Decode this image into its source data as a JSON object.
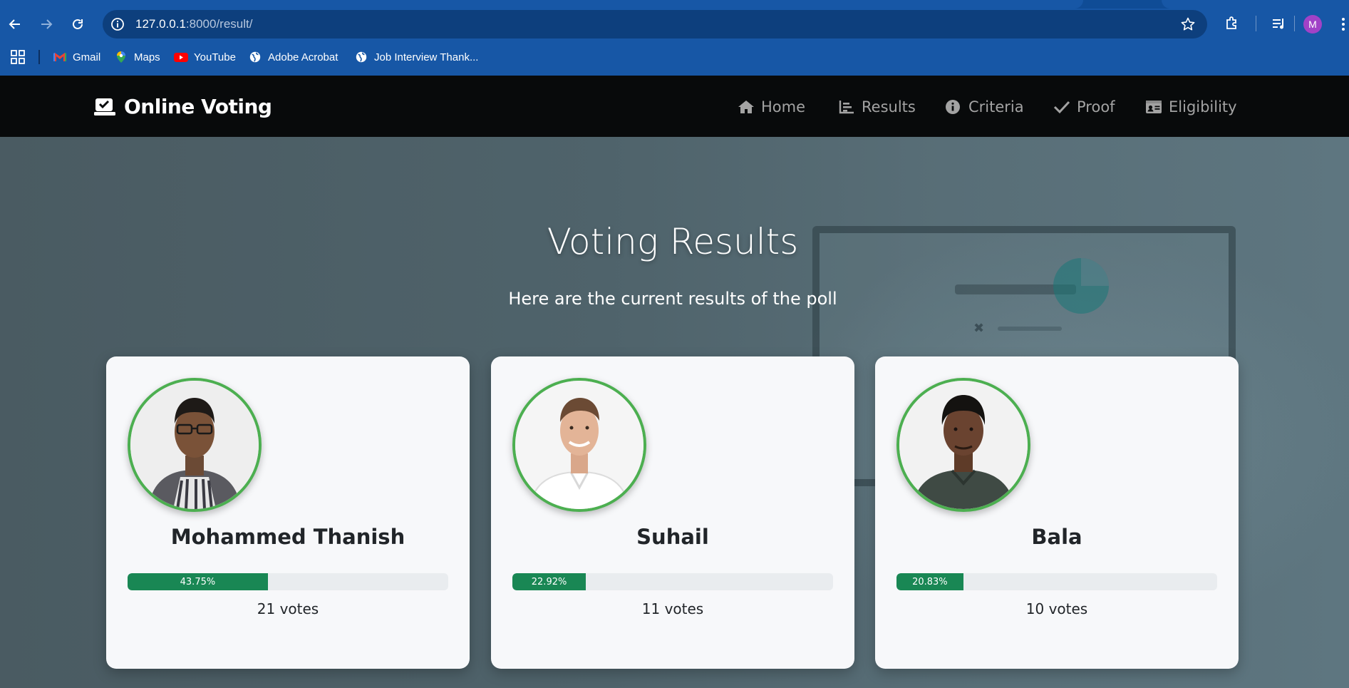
{
  "browser": {
    "url_host": "127.0.0.1",
    "url_path": ":8000/result/",
    "avatar_letter": "M",
    "bookmarks": [
      {
        "label": "Gmail",
        "icon": "gmail-icon"
      },
      {
        "label": "Maps",
        "icon": "maps-icon"
      },
      {
        "label": "YouTube",
        "icon": "youtube-icon"
      },
      {
        "label": "Adobe Acrobat",
        "icon": "globe-icon"
      },
      {
        "label": "Job Interview Thank...",
        "icon": "globe-icon"
      }
    ]
  },
  "navbar": {
    "brand": "Online Voting",
    "links": [
      {
        "label": "Home",
        "icon": "home-icon"
      },
      {
        "label": "Results",
        "icon": "bar-chart-icon"
      },
      {
        "label": "Criteria",
        "icon": "info-icon"
      },
      {
        "label": "Proof",
        "icon": "check-icon"
      },
      {
        "label": "Eligibility",
        "icon": "id-card-icon"
      }
    ]
  },
  "hero": {
    "title": "Voting Results",
    "subtitle": "Here are the current results of the poll"
  },
  "candidates": [
    {
      "name": "Mohammed Thanish",
      "percent": 43.75,
      "percent_label": "43.75%",
      "votes_label": "21 votes"
    },
    {
      "name": "Suhail",
      "percent": 22.92,
      "percent_label": "22.92%",
      "votes_label": "11 votes"
    },
    {
      "name": "Bala",
      "percent": 20.83,
      "percent_label": "20.83%",
      "votes_label": "10 votes"
    }
  ],
  "colors": {
    "chrome_blue": "#1757a6",
    "navbar_bg": "#080a0b",
    "progress_green": "#198754",
    "photo_ring": "#4caf50"
  }
}
